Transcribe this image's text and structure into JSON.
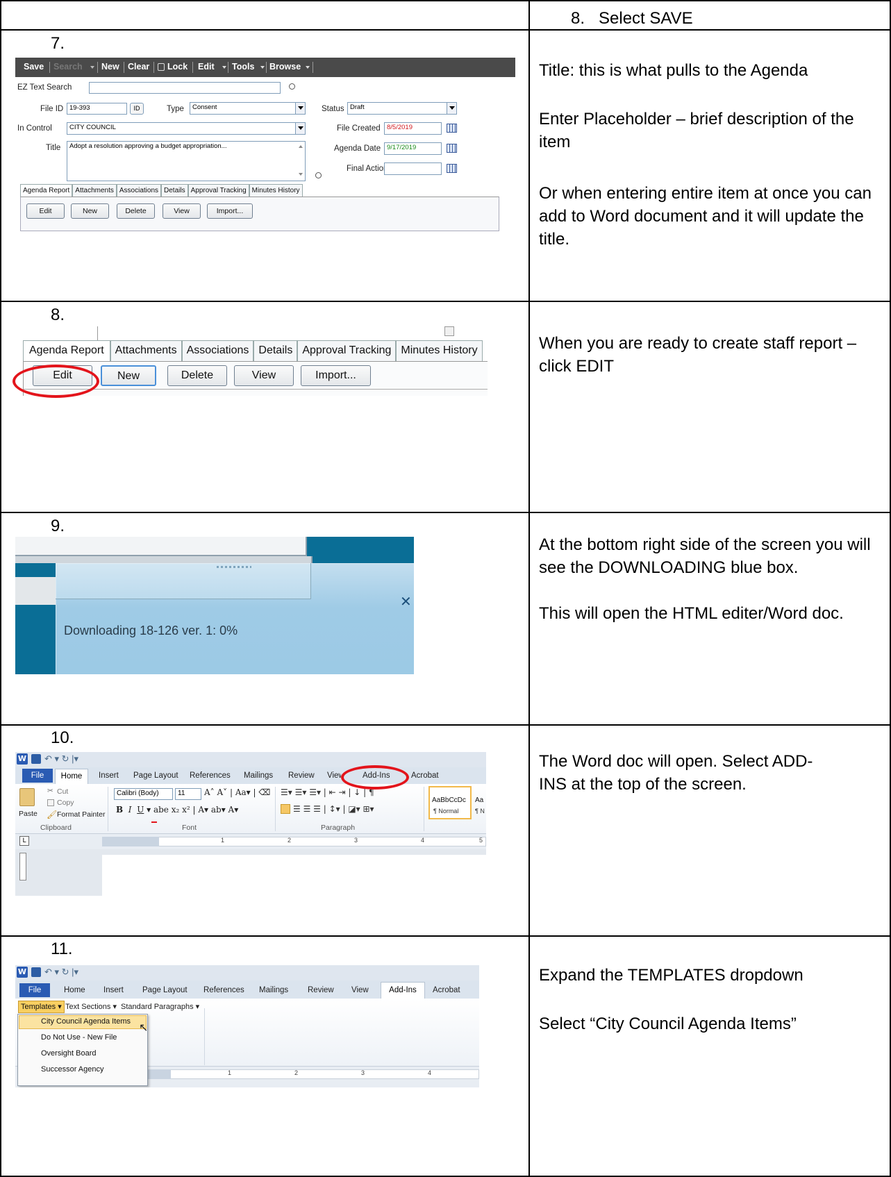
{
  "header_row": {
    "text": "8.   Select SAVE"
  },
  "rows": [
    {
      "num": "7.",
      "desc": [
        "Title: this is what pulls to the Agenda",
        "Enter Placeholder – brief description of the item",
        "Or when entering entire item at once you can add to Word document and it will update the title."
      ]
    },
    {
      "num": "8.",
      "desc": [
        "When you are ready to create staff report – click EDIT"
      ]
    },
    {
      "num": "9.",
      "desc": [
        "At the bottom right side of the screen you will see the DOWNLOADING blue box.",
        "This will open the HTML editer/Word doc."
      ]
    },
    {
      "num": "10.",
      "desc": [
        "The Word doc will open. Select ADD-INS at the top of the screen."
      ]
    },
    {
      "num": "11.",
      "desc": [
        "Expand the TEMPLATES dropdown",
        "Select “City Council Agenda Items”"
      ]
    }
  ],
  "shot7": {
    "toolbar": [
      "Save",
      "Search",
      "New",
      "Clear",
      "Lock",
      "Edit",
      "Tools",
      "Browse"
    ],
    "ez_label": "EZ Text Search",
    "file_id_label": "File ID",
    "file_id": "19-393",
    "id_btn": "ID",
    "type_label": "Type",
    "type": "Consent",
    "status_label": "Status",
    "status": "Draft",
    "in_control_label": "In Control",
    "in_control": "CITY COUNCIL",
    "file_created_label": "File Created",
    "file_created": "8/5/2019",
    "title_label": "Title",
    "title": "Adopt a resolution approving a budget appropriation...",
    "agenda_date_label": "Agenda Date",
    "agenda_date": "9/17/2019",
    "final_action_label": "Final Action",
    "tabs": [
      "Agenda Report",
      "Attachments",
      "Associations",
      "Details",
      "Approval Tracking",
      "Minutes History"
    ],
    "buttons": [
      "Edit",
      "New",
      "Delete",
      "View",
      "Import..."
    ]
  },
  "shot8": {
    "tabs": [
      "Agenda Report",
      "Attachments",
      "Associations",
      "Details",
      "Approval Tracking",
      "Minutes History"
    ],
    "buttons": [
      "Edit",
      "New",
      "Delete",
      "View",
      "Import..."
    ]
  },
  "shot9": {
    "message": "Downloading 18-126 ver. 1: 0%"
  },
  "shot10": {
    "tabs": [
      "File",
      "Home",
      "Insert",
      "Page Layout",
      "References",
      "Mailings",
      "Review",
      "View",
      "Add-Ins",
      "Acrobat"
    ],
    "cut": "Cut",
    "copy": "Copy",
    "paste": "Paste",
    "format_painter": "Format Painter",
    "font_name": "Calibri (Body)",
    "font_size": "11",
    "groups": [
      "Clipboard",
      "Font",
      "Paragraph"
    ],
    "style_preview": "AaBbCcDc",
    "style_preview2": "Aa",
    "style_name": "¶ Normal",
    "style_name2": "¶ N",
    "ruler_marks": [
      "1",
      "2",
      "3",
      "4",
      "5"
    ]
  },
  "shot11": {
    "tabs": [
      "File",
      "Home",
      "Insert",
      "Page Layout",
      "References",
      "Mailings",
      "Review",
      "View",
      "Add-Ins",
      "Acrobat"
    ],
    "menus": [
      "Templates",
      "Text Sections",
      "Standard Paragraphs"
    ],
    "dropdown_items": [
      "City Council Agenda Items",
      "Do Not Use - New File",
      "Oversight Board",
      "Successor Agency"
    ],
    "ruler_marks": [
      "1",
      "2",
      "3",
      "4"
    ]
  },
  "colors": {
    "toolbar_bg": "#4a4a4a",
    "download_blue": "#9fcbe6",
    "teal": "#0a6e96",
    "red_highlight": "#e3141b",
    "word_file_tab": "#2a5bb3"
  }
}
